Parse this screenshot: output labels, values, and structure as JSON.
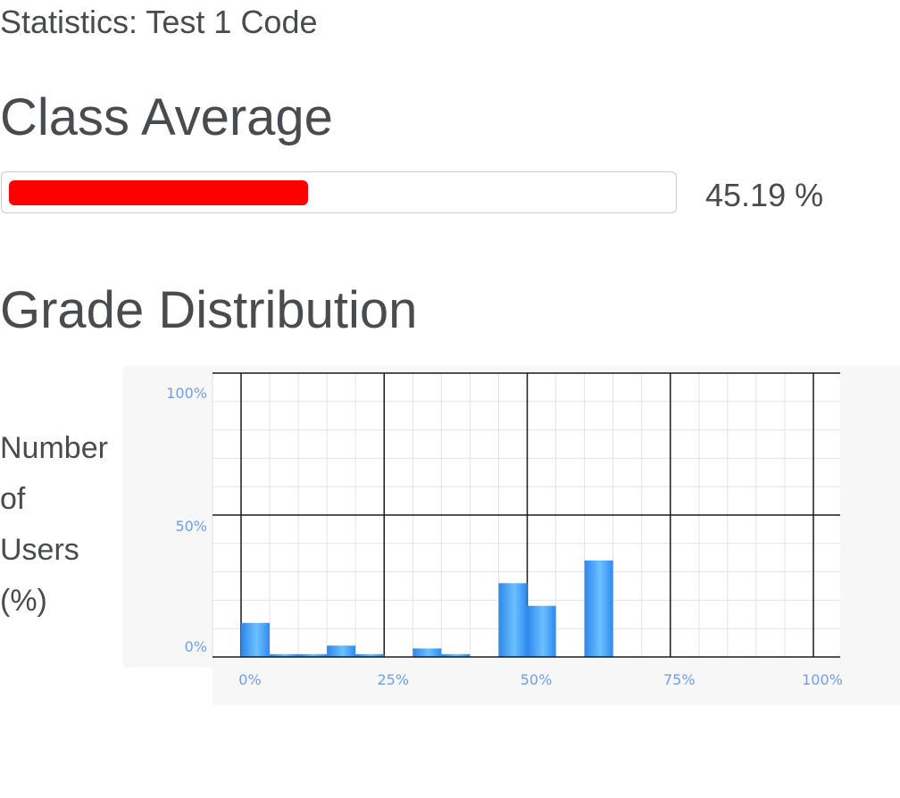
{
  "page": {
    "title": "Statistics: Test 1 Code"
  },
  "class_average": {
    "heading": "Class Average",
    "value": 45.19,
    "value_text": "45.19 %",
    "bar_color": "#ff0000"
  },
  "grade_distribution": {
    "heading": "Grade Distribution",
    "ylabel_lines": [
      "Number",
      "of",
      "Users",
      "(%)"
    ]
  },
  "colors": {
    "bar": "#2e8bf0",
    "bar_highlight": "#6cc0ff",
    "tick": "#6f9fe3"
  },
  "chart_data": {
    "type": "bar",
    "title": "",
    "xlabel": "",
    "ylabel": "Number of Users (%)",
    "x_ticks": [
      "0%",
      "25%",
      "50%",
      "75%",
      "100%"
    ],
    "y_ticks": [
      "0%",
      "50%",
      "100%"
    ],
    "xlim": [
      0,
      100
    ],
    "ylim": [
      0,
      100
    ],
    "bin_width": 5,
    "bins": [
      0,
      5,
      10,
      15,
      20,
      25,
      30,
      35,
      40,
      45,
      50,
      55,
      60,
      65,
      70,
      75,
      80,
      85,
      90,
      95
    ],
    "values": [
      12,
      1,
      1,
      4,
      1,
      0,
      3,
      1,
      0,
      26,
      18,
      0,
      34,
      0,
      0,
      0,
      0,
      0,
      0,
      0
    ],
    "grid": true
  }
}
